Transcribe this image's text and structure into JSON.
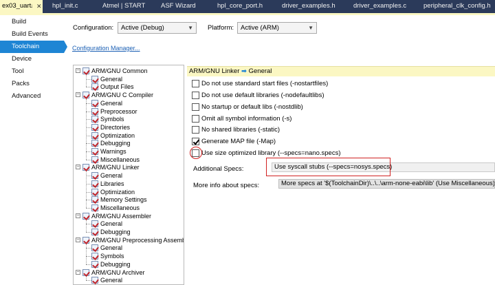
{
  "tabs": [
    {
      "label": "ex03_uart",
      "active": true
    },
    {
      "label": "hpl_init.c"
    },
    {
      "label": "Atmel | START"
    },
    {
      "label": "ASF Wizard"
    },
    {
      "label": "hpl_core_port.h"
    },
    {
      "label": "driver_examples.h"
    },
    {
      "label": "driver_examples.c"
    },
    {
      "label": "peripheral_clk_config.h"
    }
  ],
  "tab_close_glyph": "✕",
  "tab_pin_glyph": "↓",
  "sidebar": {
    "items": [
      {
        "label": "Build"
      },
      {
        "label": "Build Events"
      },
      {
        "label": "Toolchain",
        "selected": true
      },
      {
        "label": "Device"
      },
      {
        "label": "Tool"
      },
      {
        "label": "Packs"
      },
      {
        "label": "Advanced"
      }
    ]
  },
  "config": {
    "configuration_label": "Configuration:",
    "configuration_value": "Active (Debug)",
    "platform_label": "Platform:",
    "platform_value": "Active (ARM)",
    "manager_link": "Configuration Manager..."
  },
  "tree": {
    "expander_glyph": "−",
    "nodes": [
      {
        "label": "ARM/GNU Common",
        "level": 0
      },
      {
        "label": "General",
        "level": 1
      },
      {
        "label": "Output Files",
        "level": 1
      },
      {
        "label": "ARM/GNU C Compiler",
        "level": 0
      },
      {
        "label": "General",
        "level": 1
      },
      {
        "label": "Preprocessor",
        "level": 1
      },
      {
        "label": "Symbols",
        "level": 1
      },
      {
        "label": "Directories",
        "level": 1
      },
      {
        "label": "Optimization",
        "level": 1
      },
      {
        "label": "Debugging",
        "level": 1
      },
      {
        "label": "Warnings",
        "level": 1
      },
      {
        "label": "Miscellaneous",
        "level": 1
      },
      {
        "label": "ARM/GNU Linker",
        "level": 0
      },
      {
        "label": "General",
        "level": 1
      },
      {
        "label": "Libraries",
        "level": 1
      },
      {
        "label": "Optimization",
        "level": 1
      },
      {
        "label": "Memory Settings",
        "level": 1
      },
      {
        "label": "Miscellaneous",
        "level": 1
      },
      {
        "label": "ARM/GNU Assembler",
        "level": 0
      },
      {
        "label": "General",
        "level": 1
      },
      {
        "label": "Debugging",
        "level": 1
      },
      {
        "label": "ARM/GNU Preprocessing Assembler",
        "level": 0
      },
      {
        "label": "General",
        "level": 1
      },
      {
        "label": "Symbols",
        "level": 1
      },
      {
        "label": "Debugging",
        "level": 1
      },
      {
        "label": "ARM/GNU Archiver",
        "level": 0
      },
      {
        "label": "General",
        "level": 1
      }
    ]
  },
  "panel": {
    "breadcrumb_part1": "ARM/GNU Linker",
    "breadcrumb_arrow": "➡",
    "breadcrumb_part2": "General",
    "options": [
      {
        "label": "Do not use standard start files (-nostartfiles)",
        "checked": false
      },
      {
        "label": "Do not use default libraries (-nodefaultlibs)",
        "checked": false
      },
      {
        "label": "No startup or default libs (-nostdlib)",
        "checked": false
      },
      {
        "label": "Omit all symbol information (-s)",
        "checked": false
      },
      {
        "label": "No shared libraries (-static)",
        "checked": false
      },
      {
        "label": "Generate MAP file (-Map)",
        "checked": true
      },
      {
        "label": "Use size optimized library (--specs=nano.specs)",
        "checked": false
      }
    ],
    "additional_specs_label": "Additional Specs:",
    "additional_specs_value": "Use syscall stubs (--specs=nosys.specs)",
    "more_info_label": "More info about specs:",
    "more_info_value": "More specs at '$(ToolchainDir)\\..\\..\\arm-none-eabi\\lib' (Use Miscellaneous)"
  },
  "colors": {
    "tabstrip_bg": "#2b3a5a",
    "active_tab_bg": "#fbf7c3",
    "selected_nav_bg": "#1e85d4",
    "highlight_red": "#d01f1f"
  }
}
